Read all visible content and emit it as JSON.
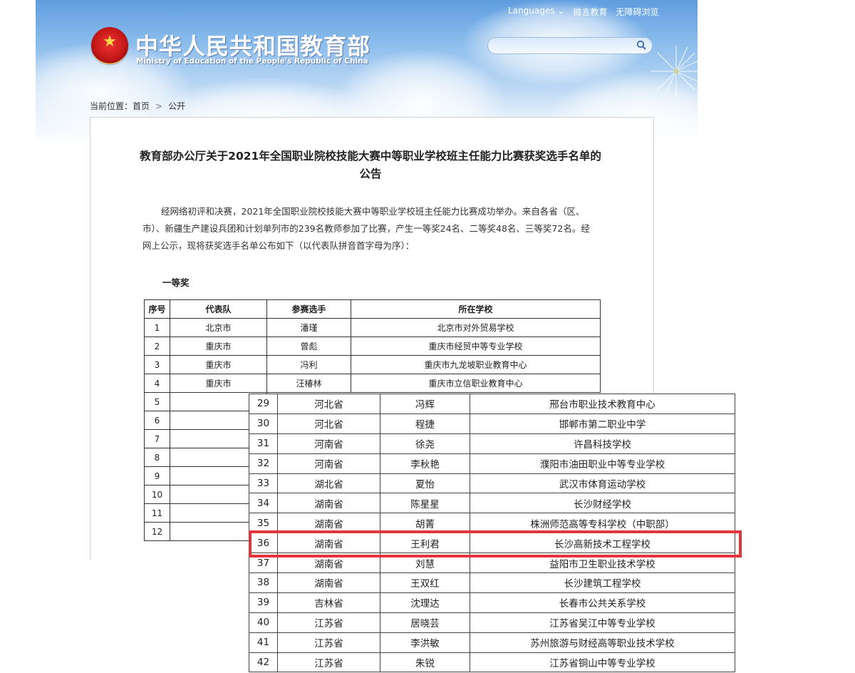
{
  "header": {
    "title": "中华人民共和国教育部",
    "subtitle": "Ministry of Education of the People's Republic of China",
    "links": [
      "Languages",
      "微言教育",
      "无障碍浏览"
    ],
    "search_placeholder": ""
  },
  "breadcrumb": {
    "prefix": "当前位置：",
    "items": [
      "首页",
      "公开"
    ],
    "separator": ">"
  },
  "article": {
    "title": "教育部办公厅关于2021年全国职业院校技能大赛中等职业学校班主任能力比赛获奖选手名单的公告",
    "paragraph": "经网络初评和决赛，2021年全国职业院校技能大赛中等职业学校班主任能力比赛成功举办。来自各省（区、市）、新疆生产建设兵团和计划单列市的239名教师参加了比赛，产生一等奖24名、二等奖48名、三等奖72名。经网上公示，现将获奖选手名单公布如下（以代表队拼音首字母为序）：",
    "prize_heading": "一等奖"
  },
  "table1": {
    "headers": [
      "序号",
      "代表队",
      "参赛选手",
      "所在学校"
    ],
    "rows": [
      [
        "1",
        "北京市",
        "潘瑾",
        "北京市对外贸易学校"
      ],
      [
        "2",
        "重庆市",
        "曾彪",
        "重庆市经贸中等专业学校"
      ],
      [
        "3",
        "重庆市",
        "冯利",
        "重庆市九龙坡职业教育中心"
      ],
      [
        "4",
        "重庆市",
        "汪椿林",
        "重庆市立信职业教育中心"
      ]
    ],
    "partial_numbers": [
      "5",
      "6",
      "7",
      "8",
      "9",
      "10",
      "11",
      "12"
    ]
  },
  "table2": {
    "rows": [
      [
        "29",
        "河北省",
        "冯辉",
        "邢台市职业技术教育中心"
      ],
      [
        "30",
        "河北省",
        "程捷",
        "邯郸市第二职业中学"
      ],
      [
        "31",
        "河南省",
        "徐尧",
        "许昌科技学校"
      ],
      [
        "32",
        "河南省",
        "李秋艳",
        "濮阳市油田职业中等专业学校"
      ],
      [
        "33",
        "湖北省",
        "夏怡",
        "武汉市体育运动学校"
      ],
      [
        "34",
        "湖南省",
        "陈星星",
        "长沙财经学校"
      ],
      [
        "35",
        "湖南省",
        "胡菁",
        "株洲师范高等专科学校（中职部）"
      ],
      [
        "36",
        "湖南省",
        "王利君",
        "长沙高新技术工程学校"
      ],
      [
        "37",
        "湖南省",
        "刘慧",
        "益阳市卫生职业技术学校"
      ],
      [
        "38",
        "湖南省",
        "王双红",
        "长沙建筑工程学校"
      ],
      [
        "39",
        "吉林省",
        "沈理达",
        "长春市公共关系学校"
      ],
      [
        "40",
        "江苏省",
        "居晓芸",
        "江苏省吴江中等专业学校"
      ],
      [
        "41",
        "江苏省",
        "李洪敏",
        "苏州旅游与财经高等职业技术学校"
      ],
      [
        "42",
        "江苏省",
        "朱锐",
        "江苏省铜山中等专业学校"
      ]
    ],
    "highlight_color": "#e3363a"
  }
}
